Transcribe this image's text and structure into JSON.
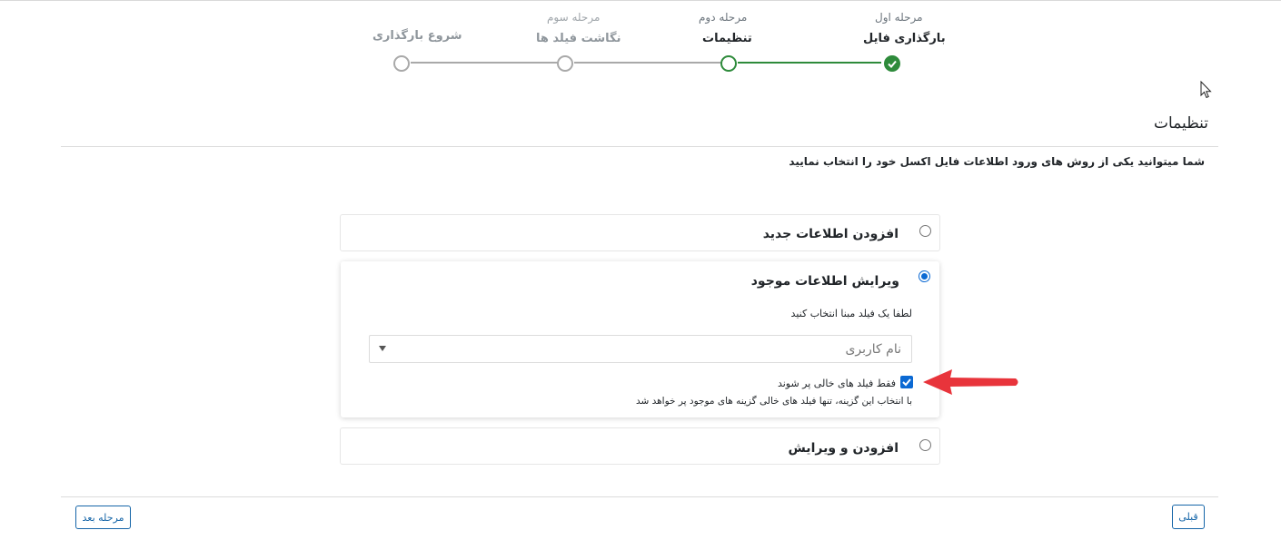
{
  "stepper": {
    "steps": [
      {
        "number_label": "مرحله اول",
        "title": "بارگذاری فایل",
        "state": "done"
      },
      {
        "number_label": "مرحله دوم",
        "title": "تنظیمات",
        "state": "current"
      },
      {
        "number_label": "مرحله سوم",
        "title": "نگاشت فیلد ها",
        "state": "pending"
      },
      {
        "number_label": "",
        "title": "شروع بارگذاری",
        "state": "pending"
      }
    ],
    "done_color": "#2e8b3b",
    "pending_color": "#a9a9a9"
  },
  "section": {
    "title": "تنظیمات",
    "instruction": "شما میتوانید یکی از روش های ورود اطلاعات فایل اکسل خود را انتخاب نمایید"
  },
  "options": [
    {
      "label": "افزودن اطلاعات جدید",
      "selected": false
    },
    {
      "label": "ویرایش اطلاعات موجود",
      "selected": true,
      "field_prompt": "لطفا یک فیلد مبنا انتخاب کنید",
      "select_value": "نام کاربری",
      "checkbox_label": "فقط فیلد های خالی پر شوند",
      "checkbox_checked": true,
      "checkbox_hint": "با انتخاب این گزینه، تنها فیلد های خالی گزینه های موجود پر خواهد شد"
    },
    {
      "label": "افزودن و ویرایش",
      "selected": false
    }
  ],
  "footer": {
    "prev_label": "قبلی",
    "next_label": "مرحله بعد"
  },
  "accent_color": "#0b69d3",
  "annotation_arrow_color": "#e8343b"
}
